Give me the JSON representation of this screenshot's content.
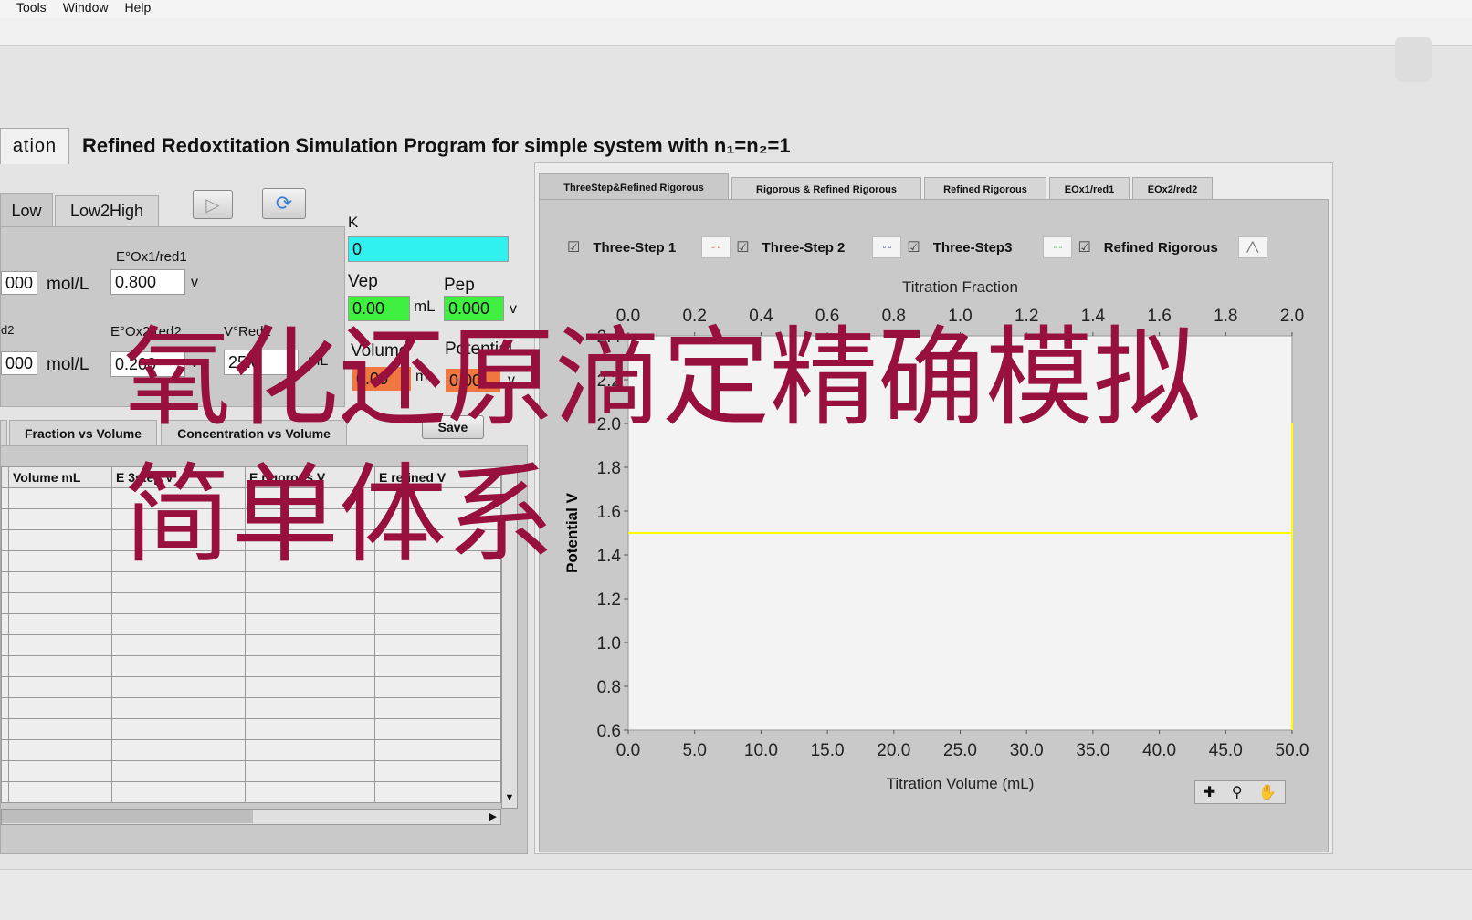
{
  "menu": [
    "Tools",
    "Window",
    "Help"
  ],
  "main_tab": "ation",
  "title": "Refined Redoxtitation Simulation Program for simple system with n₁=n₂=1",
  "mode_tabs": [
    "Low",
    "Low2High"
  ],
  "icons": {
    "run": "play-icon",
    "refresh": "refresh-icon"
  },
  "inputs": {
    "c1": "000",
    "c1_unit": "mol/L",
    "e1_label": "E°Ox1/red1",
    "e1": "0.800",
    "e1_unit": "v",
    "c2_label": "d2",
    "c2": "000",
    "c2_unit": "mol/L",
    "e2_label": "E°Ox2/red2",
    "e2": "0.200",
    "e2_unit": "v",
    "v2_label": "V°Red2",
    "v2": "25.0",
    "v2_unit": "mL"
  },
  "outputs": {
    "k_label": "K",
    "k": "0",
    "vep_label": "Vep",
    "vep": "0.00",
    "vep_unit": "mL",
    "pep_label": "Pep",
    "pep": "0.000",
    "pep_unit": "v",
    "vol_label": "Volume",
    "vol": "0.00",
    "vol_unit": "mL",
    "pot_label": "Potential",
    "pot": "0.00",
    "pot_unit": "v"
  },
  "colors": {
    "k": "#30f0f0",
    "ep": "#40f040",
    "cur": "#f07840",
    "overlay": "#98103e",
    "trace": "#ffff00"
  },
  "save_label": "Save",
  "table_tabs": [
    "Fraction vs Volume",
    "Concentration vs Volume"
  ],
  "table_headers": [
    "Volume mL",
    "E 3step V",
    "E rigorous V",
    "E refined V"
  ],
  "chart_tabs": [
    "ThreeStep&Refined Rigorous",
    "Rigorous & Refined Rigorous",
    "Refined Rigorous",
    "EOx1/red1",
    "EOx2/red2"
  ],
  "legend": [
    "Three-Step 1",
    "Three-Step 2",
    "Three-Step3",
    "Refined Rigorous"
  ],
  "chart_data": {
    "type": "line",
    "title": "",
    "xlabel": "Titration Volume (mL)",
    "x2label": "Titration Fraction",
    "ylabel": "Potential V",
    "xlim": [
      0,
      50
    ],
    "x2lim": [
      0,
      2
    ],
    "ylim": [
      0.6,
      2.4
    ],
    "xticks": [
      "0.0",
      "5.0",
      "10.0",
      "15.0",
      "20.0",
      "25.0",
      "30.0",
      "35.0",
      "40.0",
      "45.0",
      "50.0"
    ],
    "x2ticks": [
      "0.0",
      "0.2",
      "0.4",
      "0.6",
      "0.8",
      "1.0",
      "1.2",
      "1.4",
      "1.6",
      "1.8",
      "2.0"
    ],
    "yticks": [
      "0.6",
      "0.8",
      "1.0",
      "1.2",
      "1.4",
      "1.6",
      "1.8",
      "2.0",
      "2.2",
      "2.4"
    ],
    "series": [
      {
        "x": [
          0,
          50
        ],
        "y": [
          1.5,
          1.5
        ]
      }
    ]
  },
  "overlay_text": [
    "氧化还原滴定精确模拟",
    "简单体系"
  ]
}
